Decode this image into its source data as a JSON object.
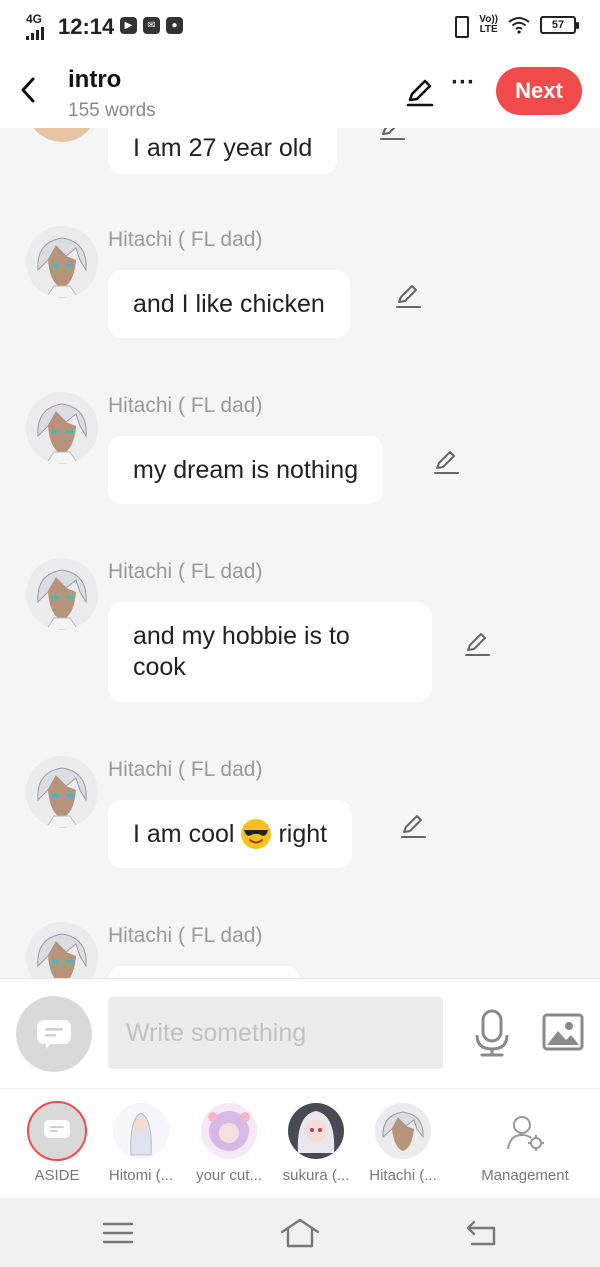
{
  "status_bar": {
    "network": "4G",
    "time": "12:14",
    "volte": "Vo))\nLTE",
    "battery": "57"
  },
  "header": {
    "title": "intro",
    "subtitle": "155 words",
    "next_label": "Next"
  },
  "messages": [
    {
      "sender": "",
      "text": "I am 27 year old"
    },
    {
      "sender": "Hitachi ( FL dad)",
      "text": "and I like chicken"
    },
    {
      "sender": "Hitachi ( FL dad)",
      "text": "my dream is nothing"
    },
    {
      "sender": "Hitachi ( FL dad)",
      "text": "and my hobbie is to cook"
    },
    {
      "sender": "Hitachi ( FL dad)",
      "text_before": "I am cool",
      "emoji": "sunglasses-emoji",
      "text_after": "right"
    },
    {
      "sender": "Hitachi ( FL dad)",
      "text": ""
    }
  ],
  "composer": {
    "placeholder": "Write something"
  },
  "characters": [
    {
      "label": "ASIDE"
    },
    {
      "label": "Hitomi (..."
    },
    {
      "label": "your cut..."
    },
    {
      "label": "sukura (..."
    },
    {
      "label": "Hitachi (..."
    },
    {
      "label": "Management"
    }
  ],
  "colors": {
    "accent": "#f24b4b",
    "background": "#f5f5f5",
    "bubble": "#ffffff",
    "sender_text": "#9a9a9a"
  }
}
